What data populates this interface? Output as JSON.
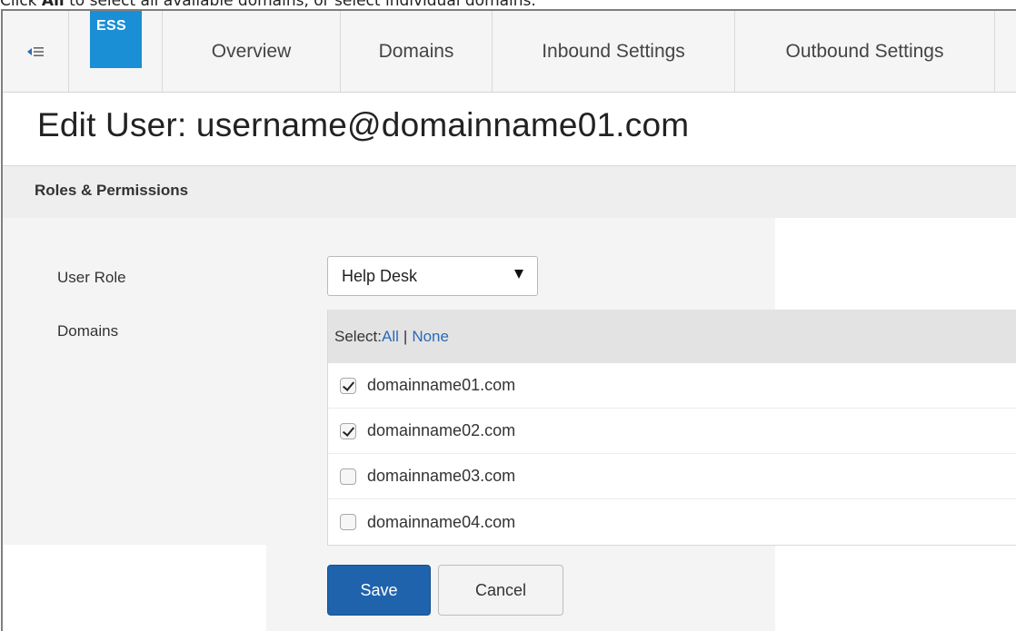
{
  "instruction": {
    "lead": "Click ",
    "keyword": "All",
    "rest": " to select all available domains, or select individual domains."
  },
  "nav": {
    "logo": "ESS",
    "tabs": [
      "Overview",
      "Domains",
      "Inbound Settings",
      "Outbound Settings"
    ]
  },
  "page": {
    "title": "Edit User: username@domainname01.com"
  },
  "section": {
    "title": "Roles & Permissions"
  },
  "form": {
    "user_role_label": "User Role",
    "user_role_value": "Help Desk",
    "domains_label": "Domains",
    "select_prefix": "Select: ",
    "select_all": "All",
    "select_separator": "|",
    "select_none": "None",
    "domains": [
      {
        "name": "domainname01.com",
        "checked": true
      },
      {
        "name": "domainname02.com",
        "checked": true
      },
      {
        "name": "domainname03.com",
        "checked": false
      },
      {
        "name": "domainname04.com",
        "checked": false
      }
    ]
  },
  "buttons": {
    "save": "Save",
    "cancel": "Cancel"
  },
  "colors": {
    "logo_bg": "#1a8fd6",
    "save_bg": "#1f63ad",
    "link": "#2a6ab8"
  },
  "icons": {
    "nav_toggle": "collapse-menu-icon",
    "dropdown": "triangle-down-icon",
    "check": "checkmark-icon"
  }
}
